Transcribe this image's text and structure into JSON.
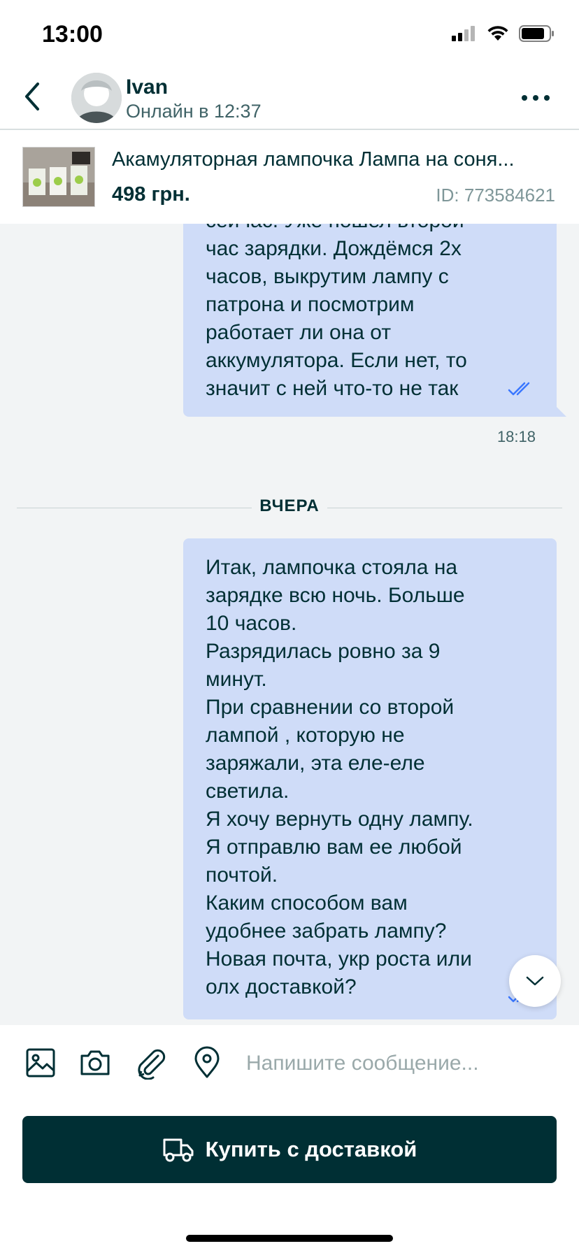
{
  "status_bar": {
    "time": "13:00"
  },
  "header": {
    "user_name": "Ivan",
    "user_status": "Онлайн в 12:37"
  },
  "product": {
    "title": "Акамуляторная лампочка Лампа на соня...",
    "price": "498 грн.",
    "id": "ID: 773584621"
  },
  "messages": [
    {
      "lines": [
        "сейчас. Уже пошел второй",
        "час зарядки. Дождёмся 2х",
        "часов, выкрутим лампу с",
        "патрона и посмотрим",
        "работает ли она от",
        "аккумулятора. Если нет, то",
        "значит с ней что-то не так"
      ],
      "time": "18:18"
    },
    {
      "lines": [
        "Итак, лампочка стояла на",
        "зарядке всю ночь. Больше",
        "10 часов.",
        "Разрядилась ровно за 9",
        "минут.",
        "При сравнении со второй",
        "лампой , которую не",
        "заряжали, эта еле-еле",
        "светила.",
        "Я хочу вернуть одну лампу.",
        "Я отправлю вам ее любой",
        "почтой.",
        "Каким способом вам",
        "удобнее забрать лампу?",
        "Новая почта, укр роста или",
        "олх доставкой?"
      ]
    }
  ],
  "date_divider": "ВЧЕРА",
  "composer": {
    "placeholder": "Напишите сообщение...",
    "buy_button_label": "Купить с доставкой"
  },
  "icons": {
    "back": "chevron-left-icon",
    "more": "more-horizontal-icon",
    "image": "image-icon",
    "camera": "camera-icon",
    "attach": "paperclip-icon",
    "location": "location-pin-icon",
    "scroll": "chevron-down-icon",
    "truck": "truck-icon"
  },
  "colors": {
    "brand_dark": "#002f34",
    "bubble": "#cfdcf8",
    "read_ticks": "#3a77ff"
  }
}
